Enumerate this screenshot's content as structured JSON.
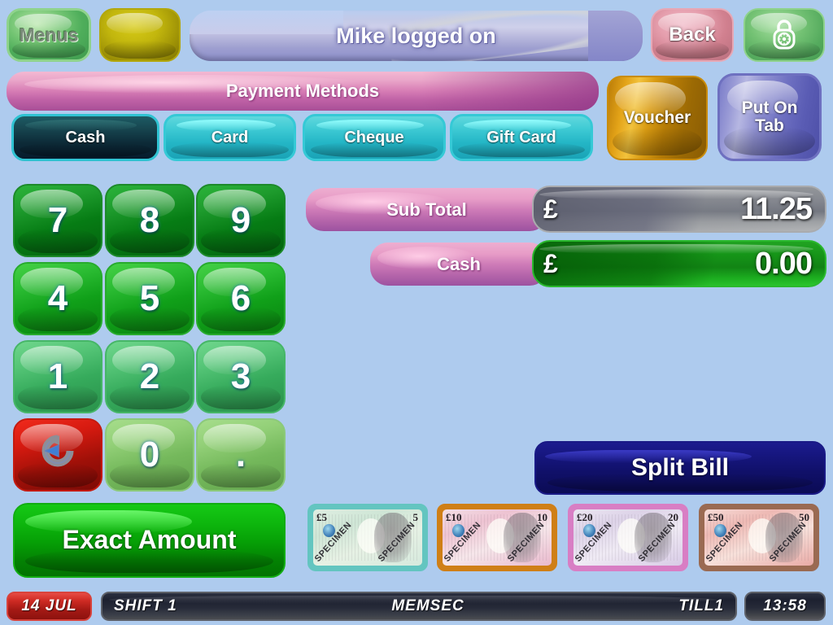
{
  "theme": {
    "background": "#aecbee",
    "accent_green": "#0ea60e",
    "accent_blue": "#14146e",
    "accent_pink": "#d87fb6",
    "status_red": "#cf2b24"
  },
  "topbar": {
    "menus_label": "Menus",
    "blank_button_label": "",
    "title": "Mike logged on",
    "back_label": "Back",
    "lock_icon": "padlock-icon"
  },
  "payment": {
    "header_label": "Payment Methods",
    "methods": [
      {
        "label": "Cash",
        "selected": true
      },
      {
        "label": "Card",
        "selected": false
      },
      {
        "label": "Cheque",
        "selected": false
      },
      {
        "label": "Gift Card",
        "selected": false
      }
    ],
    "voucher_label": "Voucher",
    "put_on_tab_label": "Put On\nTab",
    "put_on_tab_line1": "Put On",
    "put_on_tab_line2": "Tab"
  },
  "keypad": {
    "keys": [
      "7",
      "8",
      "9",
      "4",
      "5",
      "6",
      "1",
      "2",
      "3"
    ],
    "backspace_icon": "backspace-arrow-icon",
    "zero": "0",
    "decimal": ".",
    "exact_amount_label": "Exact Amount"
  },
  "totals": {
    "currency_symbol": "£",
    "rows": [
      {
        "label": "Sub Total",
        "value": "11.25"
      },
      {
        "label": "Cash",
        "value": "0.00"
      }
    ]
  },
  "actions": {
    "split_bill_label": "Split Bill"
  },
  "notes": [
    {
      "denom": "£5",
      "denom_right": "5",
      "specimen": "SPECIMEN"
    },
    {
      "denom": "£10",
      "denom_right": "10",
      "specimen": "SPECIMEN"
    },
    {
      "denom": "£20",
      "denom_right": "20",
      "specimen": "SPECIMEN"
    },
    {
      "denom": "£50",
      "denom_right": "50",
      "specimen": "SPECIMEN"
    }
  ],
  "statusbar": {
    "date": "14 JUL",
    "shift": "SHIFT 1",
    "operator": "MEMSEC",
    "till": "TILL1",
    "time": "13:58"
  }
}
